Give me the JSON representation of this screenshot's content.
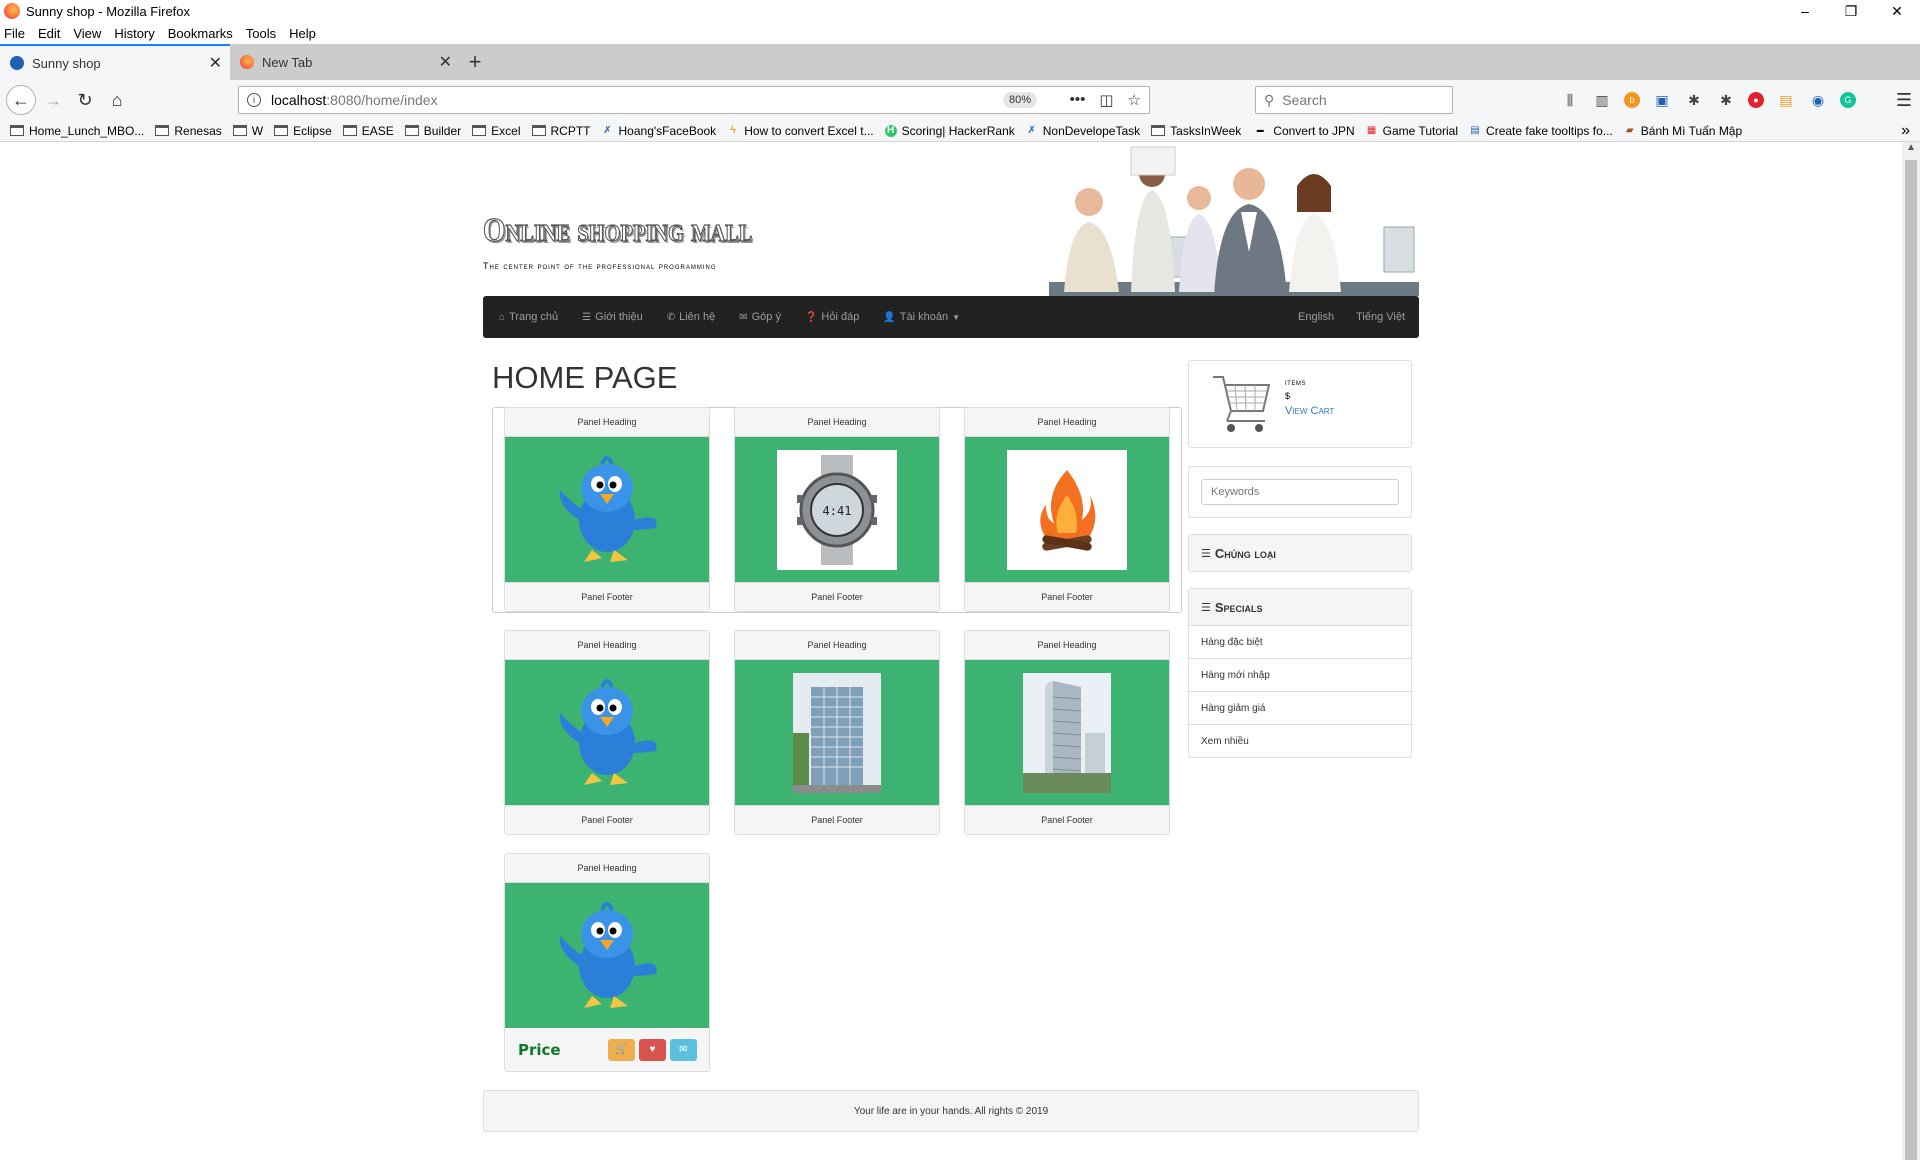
{
  "window": {
    "title": "Sunny shop - Mozilla Firefox",
    "controls": [
      "–",
      "❐",
      "✕"
    ]
  },
  "menubar": [
    "File",
    "Edit",
    "View",
    "History",
    "Bookmarks",
    "Tools",
    "Help"
  ],
  "tabs": [
    {
      "label": "Sunny shop",
      "active": true
    },
    {
      "label": "New Tab",
      "active": false
    }
  ],
  "url": {
    "host": "localhost",
    "path": ":8080/home/index",
    "zoom": "80%"
  },
  "search": {
    "placeholder": "Search"
  },
  "bookmarks": [
    {
      "label": "Home_Lunch_MBO...",
      "type": "folder"
    },
    {
      "label": "Renesas",
      "type": "folder"
    },
    {
      "label": "W",
      "type": "folder"
    },
    {
      "label": "Eclipse",
      "type": "folder"
    },
    {
      "label": "EASE",
      "type": "folder"
    },
    {
      "label": "Builder",
      "type": "folder"
    },
    {
      "label": "Excel",
      "type": "folder"
    },
    {
      "label": "RCPTT",
      "type": "folder"
    },
    {
      "label": "Hoang'sFaceBook",
      "type": "link"
    },
    {
      "label": "How to convert Excel t...",
      "type": "link"
    },
    {
      "label": "Scoring| HackerRank",
      "type": "link"
    },
    {
      "label": "NonDevelopeTask",
      "type": "link"
    },
    {
      "label": "TasksInWeek",
      "type": "folder"
    },
    {
      "label": "Convert to JPN",
      "type": "link"
    },
    {
      "label": "Game Tutorial",
      "type": "link"
    },
    {
      "label": "Create fake tooltips fo...",
      "type": "link"
    },
    {
      "label": "Bánh Mì Tuấn Mập",
      "type": "link"
    }
  ],
  "site": {
    "logo_title": "Online shopping mall",
    "logo_subtitle": "The center point of the professional programming",
    "nav": [
      {
        "label": "Trang chủ",
        "icon": "home-icon"
      },
      {
        "label": "Giới thiệu",
        "icon": "list-icon"
      },
      {
        "label": "Liên hệ",
        "icon": "phone-icon"
      },
      {
        "label": "Góp ý",
        "icon": "envelope-icon"
      },
      {
        "label": "Hỏi đáp",
        "icon": "question-icon"
      },
      {
        "label": "Tài khoản",
        "icon": "user-icon"
      }
    ],
    "lang": [
      "English",
      "Tiếng Việt"
    ],
    "page_title": "HOME PAGE",
    "cards": [
      {
        "heading": "Panel Heading",
        "footer": "Panel Footer",
        "image": "bird"
      },
      {
        "heading": "Panel Heading",
        "footer": "Panel Footer",
        "image": "watch"
      },
      {
        "heading": "Panel Heading",
        "footer": "Panel Footer",
        "image": "fire"
      },
      {
        "heading": "Panel Heading",
        "footer": "Panel Footer",
        "image": "bird"
      },
      {
        "heading": "Panel Heading",
        "footer": "Panel Footer",
        "image": "building"
      },
      {
        "heading": "Panel Heading",
        "footer": "Panel Footer",
        "image": "building"
      },
      {
        "heading": "Panel Heading",
        "price": "Price",
        "image": "bird"
      }
    ],
    "cart": {
      "items": "items",
      "dollar": "$",
      "view_cart": "View Cart"
    },
    "keywords_placeholder": "Keywords",
    "categories_title": "Chủng loại",
    "specials_title": "Specials",
    "specials": [
      "Hàng đặc biệt",
      "Hàng mới nhập",
      "Hàng giảm giá",
      "Xem nhiều"
    ],
    "footer": "Your life are in your hands. All rights © 2019"
  },
  "colors": {
    "card_image_bg": "#3cb371",
    "nav_bg": "#222222",
    "price_green": "#0a7a28",
    "btn_cart": "#f0ad4e",
    "btn_heart": "#d9534f",
    "btn_mail": "#5bc0de"
  }
}
